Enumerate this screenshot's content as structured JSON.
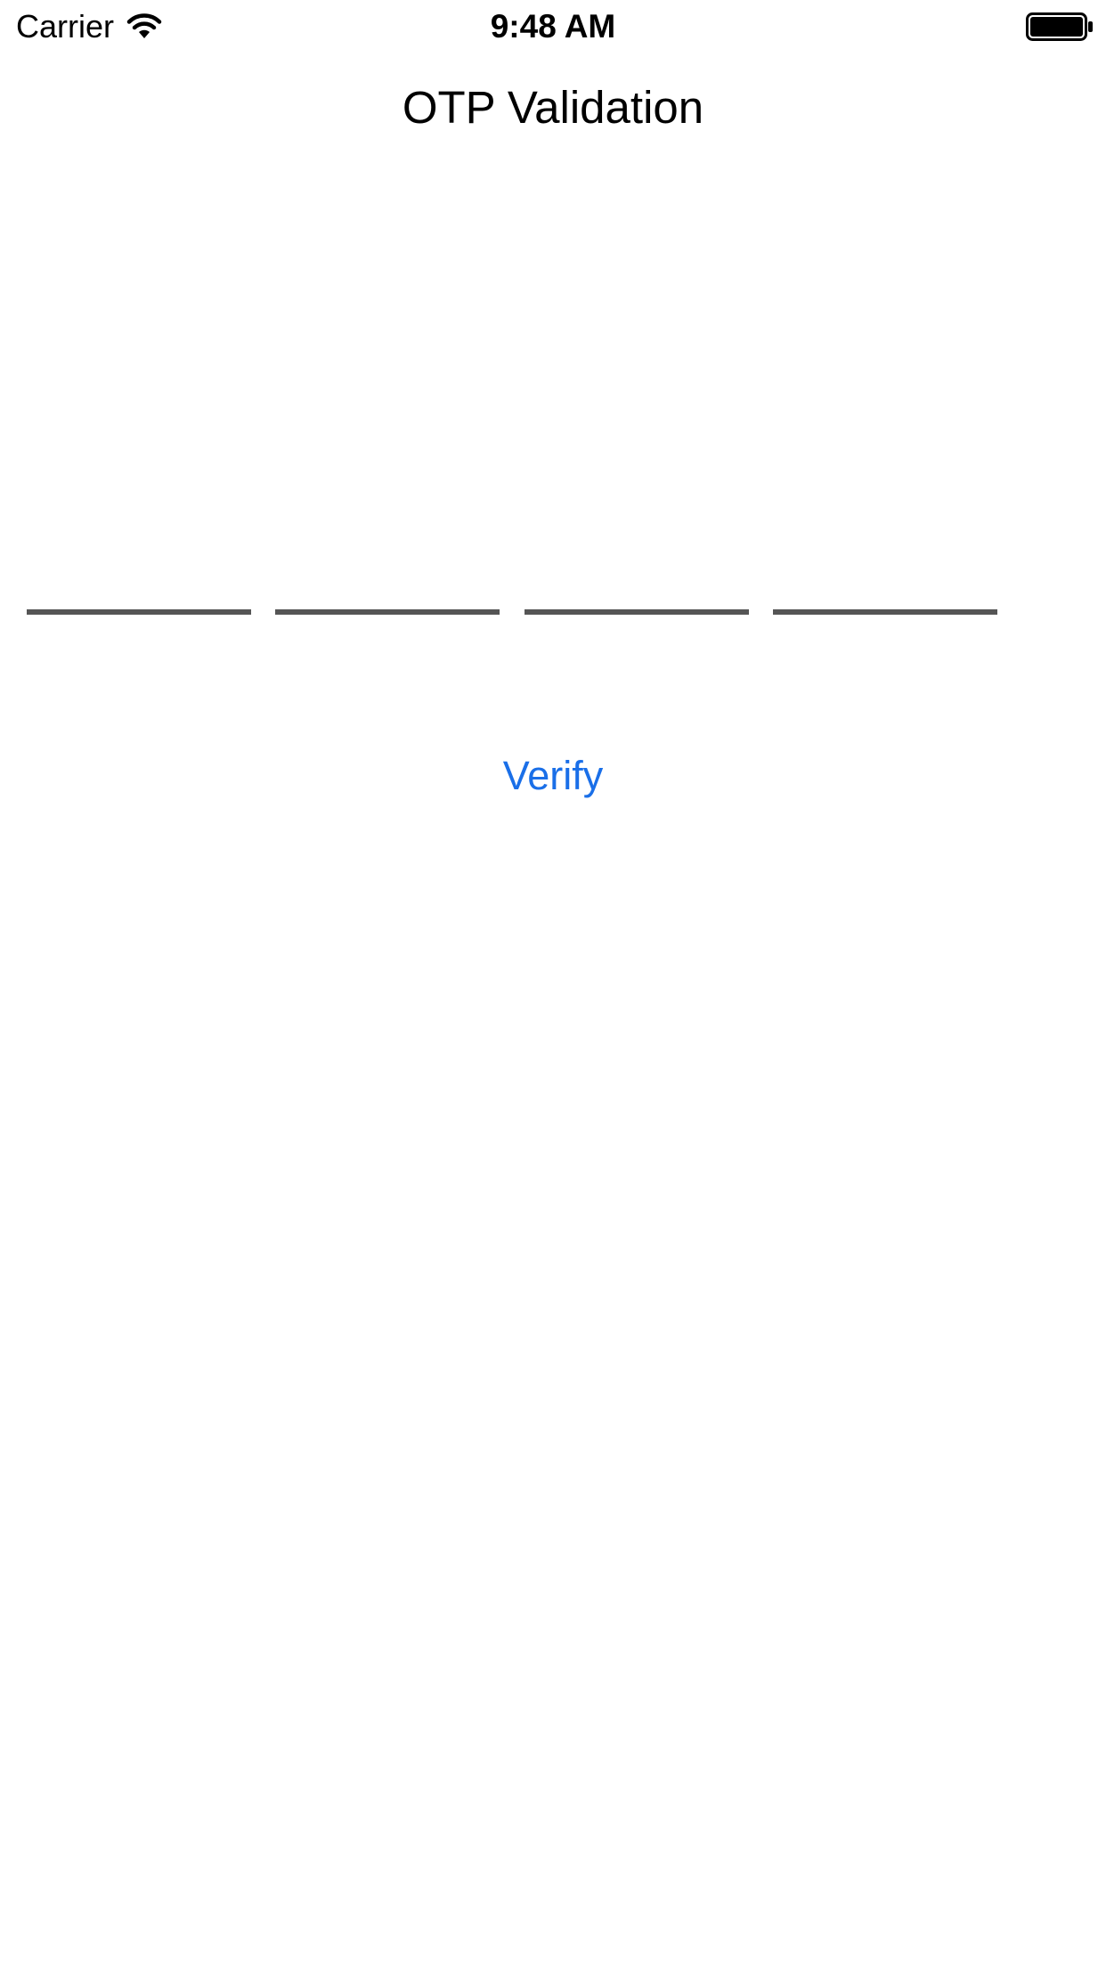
{
  "status_bar": {
    "carrier": "Carrier",
    "time": "9:48 AM",
    "wifi_icon": "wifi-icon",
    "battery_icon": "battery-icon",
    "battery_level": 1.0
  },
  "nav": {
    "title": "OTP Validation"
  },
  "otp": {
    "fields": [
      {
        "value": ""
      },
      {
        "value": ""
      },
      {
        "value": ""
      },
      {
        "value": ""
      }
    ]
  },
  "actions": {
    "verify_label": "Verify"
  },
  "colors": {
    "accent": "#1a6fe8",
    "underline": "#555555",
    "background": "#ffffff",
    "text": "#000000"
  }
}
